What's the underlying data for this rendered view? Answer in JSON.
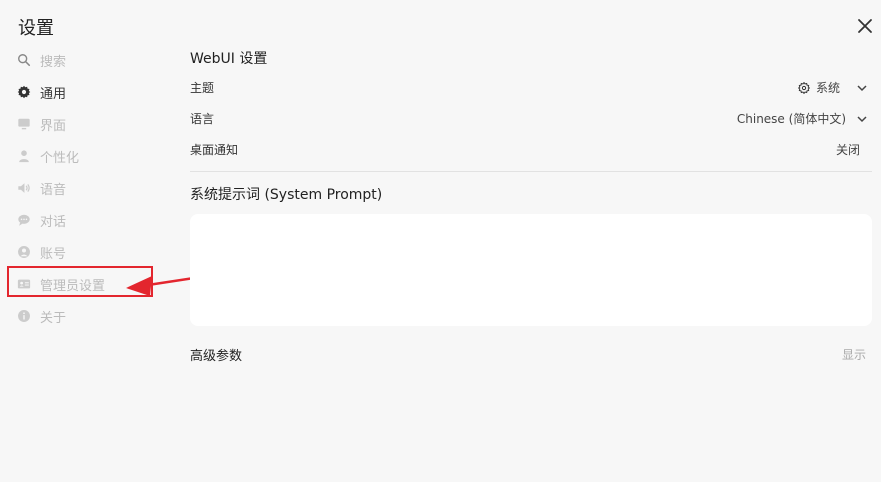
{
  "dialog": {
    "title": "设置"
  },
  "sidebar": {
    "items": [
      {
        "label": "搜索",
        "icon": "search-icon",
        "active": false
      },
      {
        "label": "通用",
        "icon": "gear-icon",
        "active": true
      },
      {
        "label": "界面",
        "icon": "monitor-icon",
        "active": false
      },
      {
        "label": "个性化",
        "icon": "user-icon",
        "active": false
      },
      {
        "label": "语音",
        "icon": "speaker-icon",
        "active": false
      },
      {
        "label": "对话",
        "icon": "chat-icon",
        "active": false
      },
      {
        "label": "账号",
        "icon": "account-icon",
        "active": false
      },
      {
        "label": "管理员设置",
        "icon": "admin-card-icon",
        "active": false
      },
      {
        "label": "关于",
        "icon": "info-icon",
        "active": false
      }
    ]
  },
  "main": {
    "section_title": "WebUI 设置",
    "theme": {
      "label": "主题",
      "value": "系统"
    },
    "language": {
      "label": "语言",
      "value": "Chinese (简体中文)"
    },
    "notifications": {
      "label": "桌面通知",
      "value": "关闭"
    },
    "system_prompt": {
      "label": "系统提示词 (System Prompt)",
      "value": ""
    },
    "advanced": {
      "label": "高级参数",
      "toggle": "显示"
    }
  },
  "colors": {
    "highlight": "#e3262e",
    "background": "#f7f7f7"
  }
}
